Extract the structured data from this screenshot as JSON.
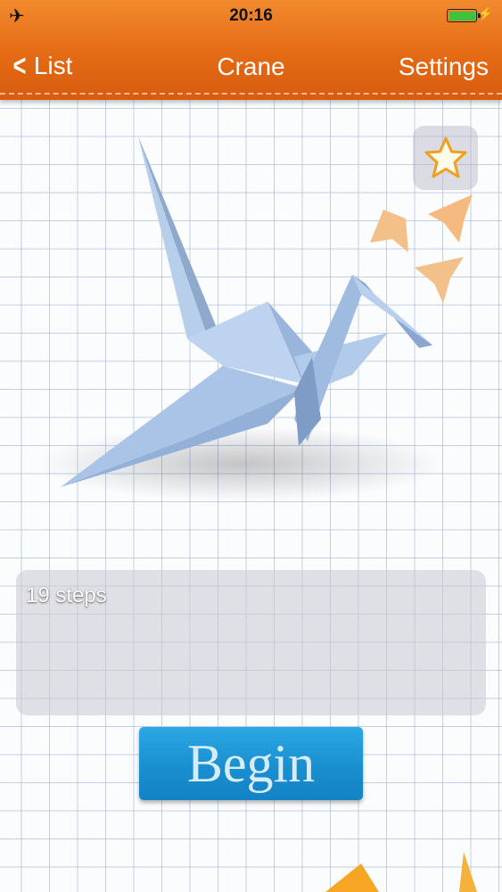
{
  "status_bar": {
    "time": "20:16",
    "airplane_icon": "airplane-icon",
    "battery_icon": "battery-icon",
    "charging_icon": "charging-bolt-icon",
    "battery_color": "#3ec23b"
  },
  "nav": {
    "back_label": "List",
    "back_icon": "chevron-left-icon",
    "title": "Crane",
    "settings_label": "Settings",
    "bar_color": "#e46a14"
  },
  "favorite": {
    "icon": "star-icon",
    "star_color": "#f0a020"
  },
  "model_image": {
    "subject": "crane-origami-illustration",
    "crane_color": "#a9c4e6",
    "bird_color": "#f4c08a"
  },
  "info_panel": {
    "steps_text": "19 steps"
  },
  "begin_button": {
    "label": "Begin",
    "color": "#1a8fd0"
  }
}
